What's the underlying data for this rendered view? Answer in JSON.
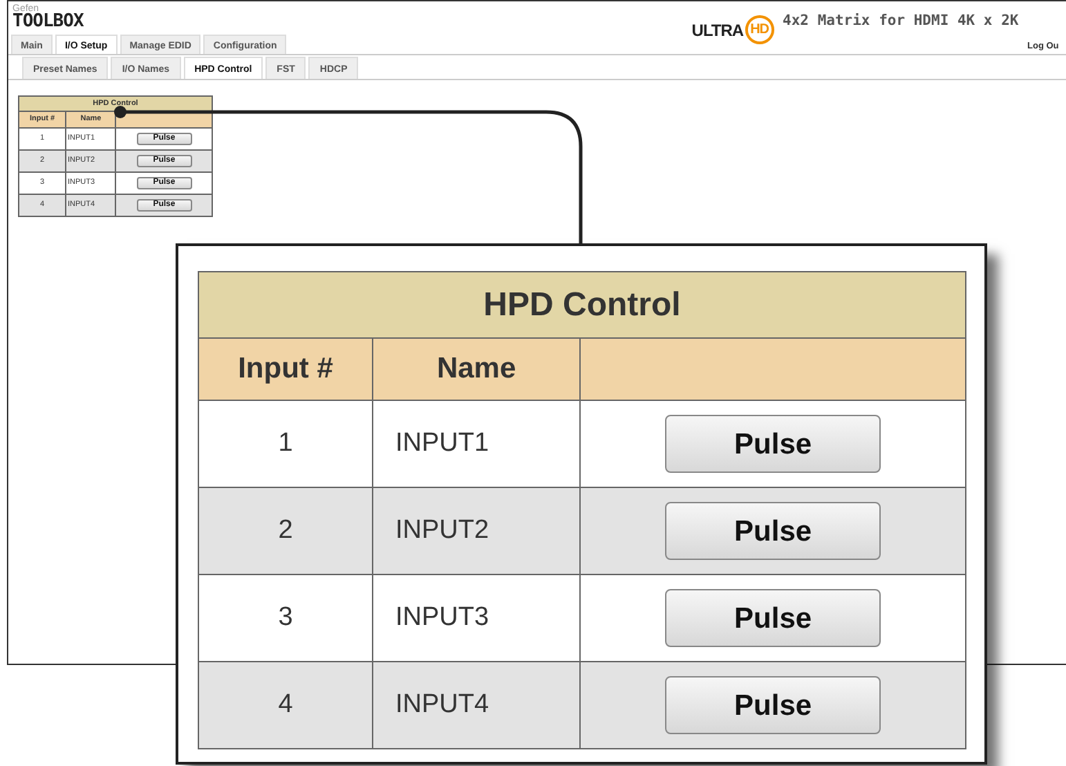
{
  "header": {
    "brand_small": "Gefen",
    "brand": "TOOLBOX",
    "ultra": "ULTRA",
    "hd": "HD",
    "title": "4x2 Matrix for HDMI 4K x 2K",
    "logout": "Log Ou"
  },
  "tabs": [
    {
      "label": "Main",
      "selected": false
    },
    {
      "label": "I/O Setup",
      "selected": true
    },
    {
      "label": "Manage EDID",
      "selected": false
    },
    {
      "label": "Configuration",
      "selected": false
    }
  ],
  "subtabs": [
    {
      "label": "Preset Names",
      "selected": false
    },
    {
      "label": "I/O Names",
      "selected": false
    },
    {
      "label": "HPD Control",
      "selected": true
    },
    {
      "label": "FST",
      "selected": false
    },
    {
      "label": "HDCP",
      "selected": false
    }
  ],
  "table": {
    "title": "HPD Control",
    "columns": [
      "Input #",
      "Name"
    ],
    "rows": [
      {
        "input": "1",
        "name": "INPUT1",
        "button": "Pulse"
      },
      {
        "input": "2",
        "name": "INPUT2",
        "button": "Pulse"
      },
      {
        "input": "3",
        "name": "INPUT3",
        "button": "Pulse"
      },
      {
        "input": "4",
        "name": "INPUT4",
        "button": "Pulse"
      }
    ]
  },
  "callout": {
    "title": "HPD Control",
    "columns": [
      "Input #",
      "Name"
    ],
    "rows": [
      {
        "input": "1",
        "name": "INPUT1",
        "button": "Pulse"
      },
      {
        "input": "2",
        "name": "INPUT2",
        "button": "Pulse"
      },
      {
        "input": "3",
        "name": "INPUT3",
        "button": "Pulse"
      },
      {
        "input": "4",
        "name": "INPUT4",
        "button": "Pulse"
      }
    ]
  }
}
